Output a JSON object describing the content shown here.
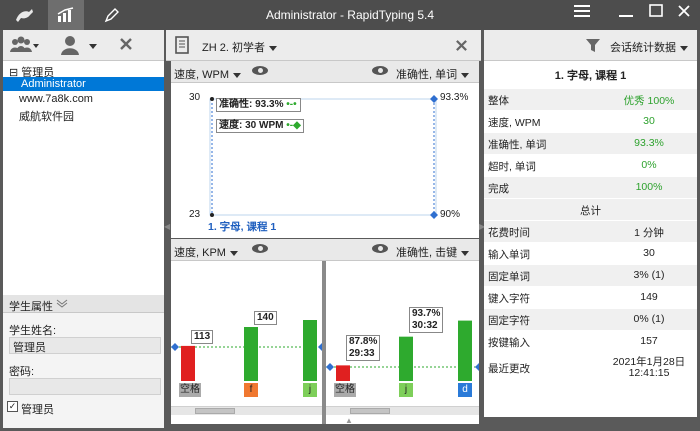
{
  "window": {
    "title": "Administrator - RapidTyping 5.4",
    "menu_icon": "hamburger-icon",
    "minimize_icon": "minimize-icon",
    "maximize_icon": "maximize-icon",
    "close_icon": "close-icon"
  },
  "users_panel": {
    "tree": [
      {
        "label": "管理员",
        "toggle": "⊟"
      },
      {
        "label": "Administrator",
        "selected": true
      },
      {
        "label": "www.7a8k.com"
      },
      {
        "label": "威航软件园"
      }
    ],
    "properties_header": "学生属性",
    "name_label": "学生姓名:",
    "name_value": "管理员",
    "password_label": "密码:",
    "password_value": "",
    "admin_checkbox_label": "管理员",
    "admin_checked": true
  },
  "course": {
    "selector": "ZH 2. 初学者"
  },
  "chart_top": {
    "left_metric": "速度, WPM",
    "right_metric": "准确性, 单词",
    "lesson_label": "1. 字母, 课程 1",
    "tooltip_accuracy": "准确性: 93.3%",
    "tooltip_speed": "速度: 30 WPM",
    "y_left_top": "30",
    "y_left_bottom": "23",
    "y_right_top": "93.3%",
    "y_right_bottom": "90%"
  },
  "chart_bottom": {
    "left_metric": "速度, KPM",
    "right_metric": "准确性, 击键"
  },
  "chart_data": [
    {
      "type": "line",
      "categories": [
        "1. 字母, 课程 1"
      ],
      "series": [
        {
          "name": "速度, WPM",
          "values": [
            30
          ]
        },
        {
          "name": "准确性, 单词",
          "values": [
            93.3
          ]
        }
      ],
      "ylim_left": [
        23,
        30
      ],
      "ylim_right": [
        90,
        93.3
      ]
    },
    {
      "type": "bar",
      "ylabel": "速度, KPM",
      "categories": [
        "空格",
        "f",
        "j"
      ],
      "values": [
        113,
        140,
        150
      ],
      "colors": [
        "#e02020",
        "#2eaa2e",
        "#2eaa2e"
      ],
      "key_colors": [
        "#aaaaaa",
        "#f07830",
        "#7ecf5a"
      ],
      "value_labels": [
        "113",
        "140",
        ""
      ]
    },
    {
      "type": "bar",
      "ylabel": "准确性, 击键",
      "categories": [
        "空格",
        "j",
        "d"
      ],
      "values": [
        87.8,
        93.7,
        97
      ],
      "time_labels": [
        "29:33",
        "30:32",
        ""
      ],
      "colors": [
        "#e02020",
        "#2eaa2e",
        "#2eaa2e"
      ],
      "key_colors": [
        "#aaaaaa",
        "#7ecf5a",
        "#2a7ad8"
      ],
      "value_labels": [
        "87.8%",
        "93.7%",
        ""
      ]
    }
  ],
  "stats": {
    "dropdown": "会话统计数据",
    "title": "1. 字母, 课程 1",
    "rows": [
      {
        "k": "整体",
        "v": "优秀 100%",
        "green": true
      },
      {
        "k": "速度, WPM",
        "v": "30",
        "green": true
      },
      {
        "k": "准确性, 单词",
        "v": "93.3%",
        "green": true
      },
      {
        "k": "超时, 单词",
        "v": "0%",
        "green": true
      },
      {
        "k": "完成",
        "v": "100%",
        "green": true
      }
    ],
    "total_label": "总计",
    "total_rows": [
      {
        "k": "花费时间",
        "v": "1 分钟"
      },
      {
        "k": "输入单词",
        "v": "30"
      },
      {
        "k": "固定单词",
        "v": "3% (1)"
      },
      {
        "k": "键入字符",
        "v": "149"
      },
      {
        "k": "固定字符",
        "v": "0% (1)"
      },
      {
        "k": "按键输入",
        "v": "157"
      }
    ],
    "last_change_label": "最近更改",
    "last_change_date": "2021年1月28日",
    "last_change_time": "12:41:15"
  }
}
